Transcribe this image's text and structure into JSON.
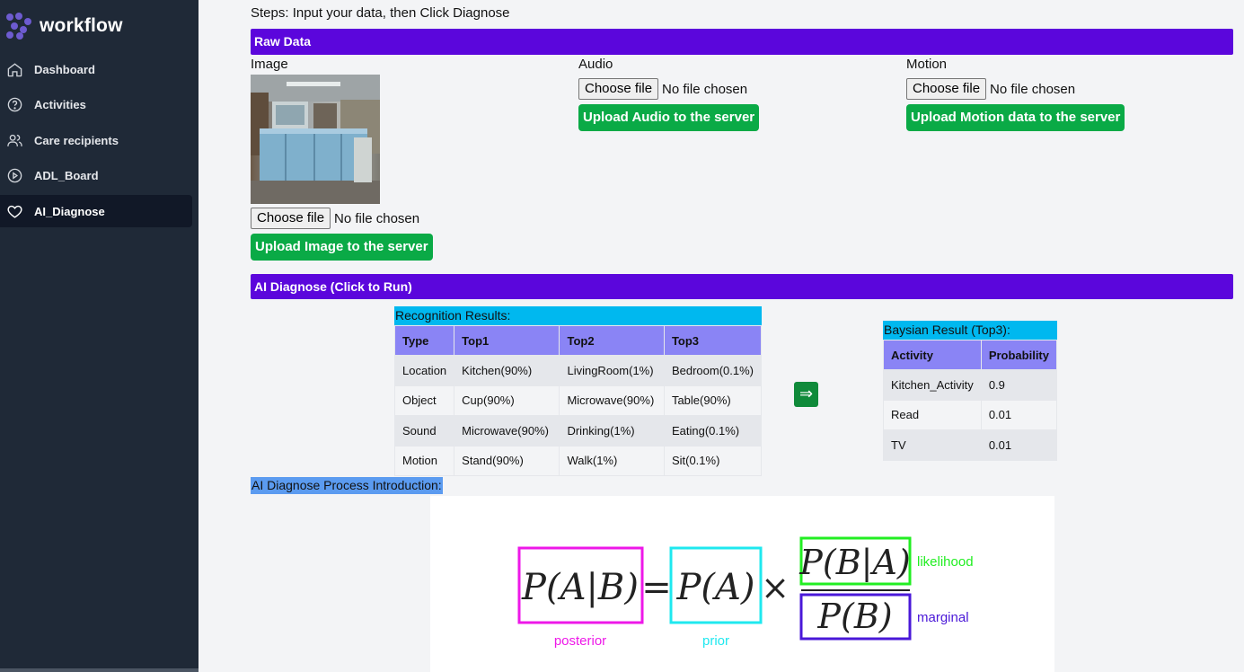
{
  "app": {
    "name": "workflow"
  },
  "sidebar": {
    "items": [
      {
        "label": "Dashboard",
        "icon": "home-icon"
      },
      {
        "label": "Activities",
        "icon": "question-circle-icon"
      },
      {
        "label": "Care recipients",
        "icon": "users-icon"
      },
      {
        "label": "ADL_Board",
        "icon": "play-circle-icon"
      },
      {
        "label": "AI_Diagnose",
        "icon": "heart-icon",
        "active": true
      }
    ]
  },
  "steps_text": "Steps: Input your data, then Click Diagnose",
  "raw_data": {
    "header": "Raw Data",
    "image": {
      "label": "Image",
      "choose_label": "Choose file",
      "status": "No file chosen",
      "upload_label": "Upload Image to the server"
    },
    "audio": {
      "label": "Audio",
      "choose_label": "Choose file",
      "status": "No file chosen",
      "upload_label": "Upload Audio to the server"
    },
    "motion": {
      "label": "Motion",
      "choose_label": "Choose file",
      "status": "No file chosen",
      "upload_label": "Upload Motion data to the server"
    }
  },
  "diagnose": {
    "header": "AI Diagnose (Click to Run)",
    "arrow_glyph": "⇒",
    "recognition": {
      "title": "Recognition Results:",
      "columns": [
        "Type",
        "Top1",
        "Top2",
        "Top3"
      ],
      "rows": [
        [
          "Location",
          "Kitchen(90%)",
          "LivingRoom(1%)",
          "Bedroom(0.1%)"
        ],
        [
          "Object",
          "Cup(90%)",
          "Microwave(90%)",
          "Table(90%)"
        ],
        [
          "Sound",
          "Microwave(90%)",
          "Drinking(1%)",
          "Eating(0.1%)"
        ],
        [
          "Motion",
          "Stand(90%)",
          "Walk(1%)",
          "Sit(0.1%)"
        ]
      ]
    },
    "bayesian": {
      "title": "Baysian Result (Top3):",
      "columns": [
        "Activity",
        "Probability"
      ],
      "rows": [
        [
          "Kitchen_Activity",
          "0.9"
        ],
        [
          "Read",
          "0.01"
        ],
        [
          "TV",
          "0.01"
        ]
      ]
    }
  },
  "intro": {
    "label": "AI Diagnose Process Introduction:",
    "formula": {
      "posterior": "P(A|B)",
      "equals": "=",
      "prior": "P(A)",
      "times": "×",
      "likelihood": "P(B|A)",
      "marginal": "P(B)",
      "posterior_caption": "posterior",
      "prior_caption": "prior",
      "likelihood_caption": "likelihood",
      "marginal_caption": "marginal",
      "colors": {
        "posterior": "#ee18e8",
        "prior": "#1fe8ef",
        "likelihood": "#22ee22",
        "marginal": "#4a18d8"
      }
    }
  },
  "colors": {
    "sidebar": "#1f2937",
    "section_bar": "#5b06dc",
    "upload_button": "#0aaa46",
    "table_header": "#8a84f5",
    "title_cyan": "#00b8ef"
  }
}
